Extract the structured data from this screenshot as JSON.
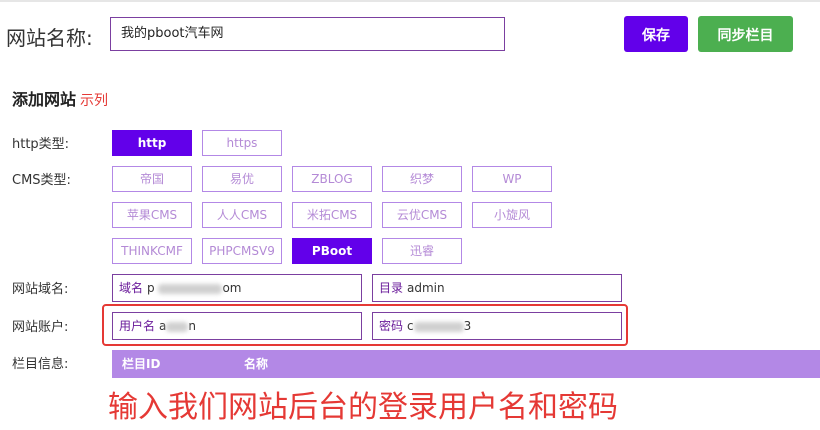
{
  "site_name": {
    "label": "网站名称:",
    "value": "我的pboot汽车网"
  },
  "buttons": {
    "save": "保存",
    "sync": "同步栏目"
  },
  "section": {
    "title": "添加网站",
    "example": "示列"
  },
  "http_type": {
    "label": "http类型:",
    "options": [
      "http",
      "https"
    ],
    "selected": "http"
  },
  "cms_type": {
    "label": "CMS类型:",
    "options": [
      "帝国",
      "易优",
      "ZBLOG",
      "织梦",
      "WP",
      "苹果CMS",
      "人人CMS",
      "米拓CMS",
      "云优CMS",
      "小旋风",
      "THINKCMF",
      "PHPCMSV9",
      "PBoot",
      "迅睿"
    ],
    "selected": "PBoot"
  },
  "domain_row": {
    "label": "网站域名:",
    "domain_label": "域名",
    "domain_value_visible": "p",
    "domain_value_suffix": "om",
    "dir_label": "目录",
    "dir_value": "admin"
  },
  "account_row": {
    "label": "网站账户:",
    "username_label": "用户名",
    "username_visible": "a",
    "username_suffix": "n",
    "password_label": "密码",
    "password_visible": "c",
    "password_suffix": "3"
  },
  "column_info": {
    "label": "栏目信息:",
    "headers": [
      "栏目ID",
      "名称"
    ]
  },
  "caption": "输入我们网站后台的登录用户名和密码",
  "colors": {
    "primary": "#6200ea",
    "success": "#4caf50",
    "option_border": "#b388e6",
    "annotation_red": "#e53935",
    "table_header": "#b388e6"
  }
}
